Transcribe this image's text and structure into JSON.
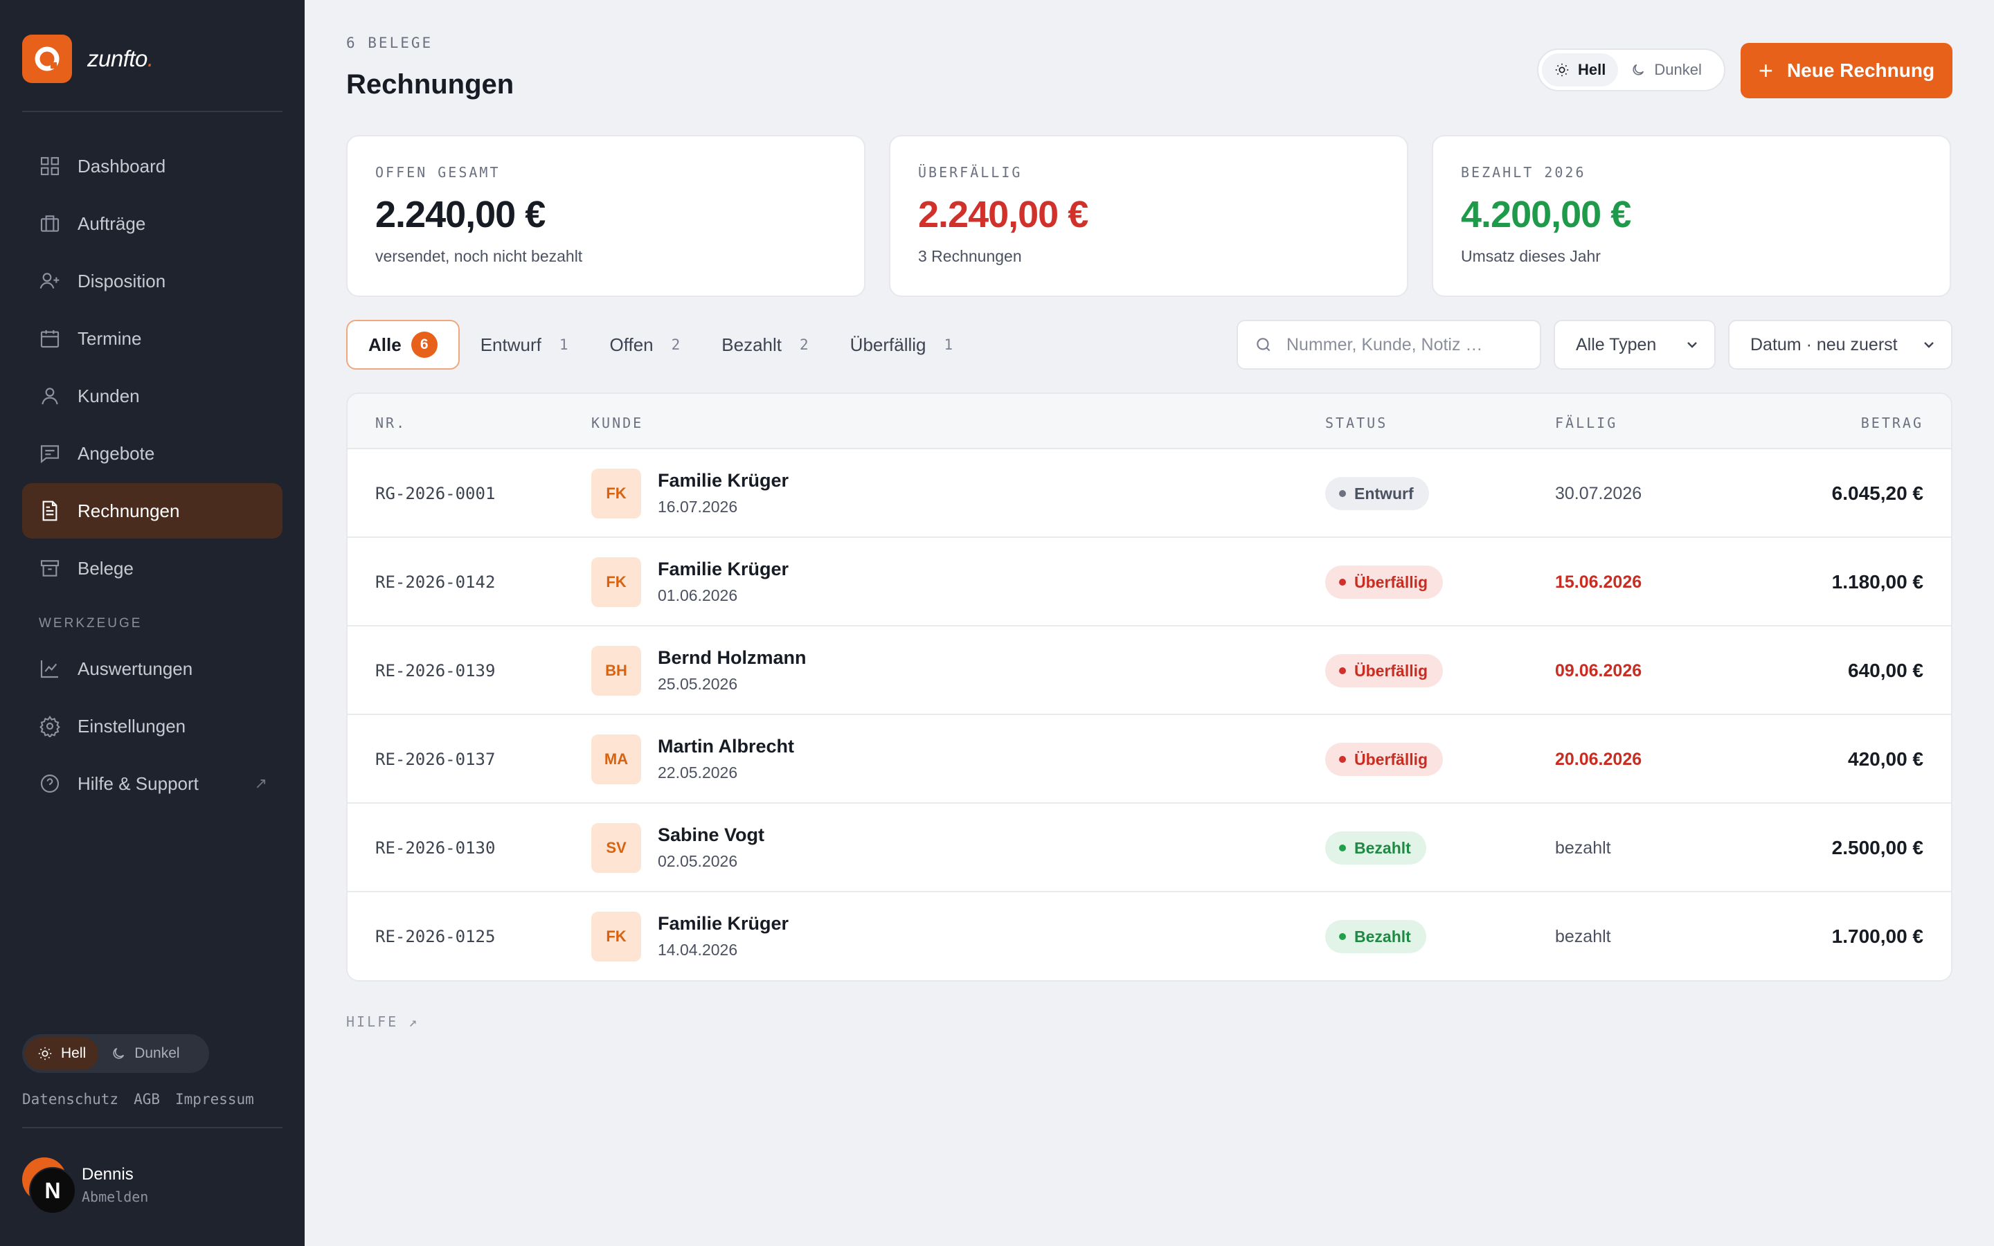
{
  "brand": {
    "name": "zunfto",
    "dot": ".",
    "accent": "#e8611a"
  },
  "sidebar": {
    "nav": [
      {
        "label": "Dashboard",
        "icon": "dashboard-icon"
      },
      {
        "label": "Aufträge",
        "icon": "briefcase-icon"
      },
      {
        "label": "Disposition",
        "icon": "user-plus-icon"
      },
      {
        "label": "Termine",
        "icon": "calendar-icon"
      },
      {
        "label": "Kunden",
        "icon": "user-icon"
      },
      {
        "label": "Angebote",
        "icon": "message-icon"
      },
      {
        "label": "Rechnungen",
        "icon": "document-icon",
        "active": true
      },
      {
        "label": "Belege",
        "icon": "archive-icon"
      }
    ],
    "section_label": "WERKZEUGE",
    "tools": [
      {
        "label": "Auswertungen",
        "icon": "chart-icon"
      },
      {
        "label": "Einstellungen",
        "icon": "gear-icon"
      },
      {
        "label": "Hilfe & Support",
        "icon": "help-icon",
        "external": "↗"
      }
    ],
    "theme": {
      "light": "Hell",
      "dark": "Dunkel"
    },
    "legal": [
      "Datenschutz",
      "AGB",
      "Impressum"
    ],
    "user": {
      "name": "Dennis",
      "initial": "N",
      "action": "Abmelden"
    }
  },
  "header": {
    "eyebrow": "6 BELEGE",
    "title": "Rechnungen",
    "theme": {
      "light": "Hell",
      "dark": "Dunkel"
    },
    "new_button": "Neue Rechnung"
  },
  "summary": [
    {
      "label": "OFFEN GESAMT",
      "value": "2.240,00 €",
      "sub": "versendet, noch nicht bezahlt",
      "color": "#171b23"
    },
    {
      "label": "ÜBERFÄLLIG",
      "value": "2.240,00 €",
      "sub": "3 Rechnungen",
      "color": "#d0312a"
    },
    {
      "label": "BEZAHLT 2026",
      "value": "4.200,00 €",
      "sub": "Umsatz dieses Jahr",
      "color": "#1e9a4a"
    }
  ],
  "filters": {
    "tabs": [
      {
        "label": "Alle",
        "count": "6",
        "active": true
      },
      {
        "label": "Entwurf",
        "count": "1"
      },
      {
        "label": "Offen",
        "count": "2"
      },
      {
        "label": "Bezahlt",
        "count": "2"
      },
      {
        "label": "Überfällig",
        "count": "1"
      }
    ],
    "search_placeholder": "Nummer, Kunde, Notiz …",
    "type_select": "Alle Typen",
    "sort_select": "Datum · neu zuerst"
  },
  "table": {
    "columns": {
      "nr": "NR.",
      "customer": "KUNDE",
      "status": "STATUS",
      "due": "FÄLLIG",
      "amount": "BETRAG"
    },
    "rows": [
      {
        "nr": "RG-2026-0001",
        "initials": "FK",
        "name": "Familie Krüger",
        "date": "16.07.2026",
        "status": "Entwurf",
        "status_kind": "entwurf",
        "due": "30.07.2026",
        "due_overdue": false,
        "amount": "6.045,20 €"
      },
      {
        "nr": "RE-2026-0142",
        "initials": "FK",
        "name": "Familie Krüger",
        "date": "01.06.2026",
        "status": "Überfällig",
        "status_kind": "over",
        "due": "15.06.2026",
        "due_overdue": true,
        "amount": "1.180,00 €"
      },
      {
        "nr": "RE-2026-0139",
        "initials": "BH",
        "name": "Bernd Holzmann",
        "date": "25.05.2026",
        "status": "Überfällig",
        "status_kind": "over",
        "due": "09.06.2026",
        "due_overdue": true,
        "amount": "640,00 €"
      },
      {
        "nr": "RE-2026-0137",
        "initials": "MA",
        "name": "Martin Albrecht",
        "date": "22.05.2026",
        "status": "Überfällig",
        "status_kind": "over",
        "due": "20.06.2026",
        "due_overdue": true,
        "amount": "420,00 €"
      },
      {
        "nr": "RE-2026-0130",
        "initials": "SV",
        "name": "Sabine Vogt",
        "date": "02.05.2026",
        "status": "Bezahlt",
        "status_kind": "paid",
        "due": "bezahlt",
        "due_overdue": false,
        "amount": "2.500,00 €"
      },
      {
        "nr": "RE-2026-0125",
        "initials": "FK",
        "name": "Familie Krüger",
        "date": "14.04.2026",
        "status": "Bezahlt",
        "status_kind": "paid",
        "due": "bezahlt",
        "due_overdue": false,
        "amount": "1.700,00 €"
      }
    ]
  },
  "footer": {
    "help": "HILFE ↗"
  }
}
